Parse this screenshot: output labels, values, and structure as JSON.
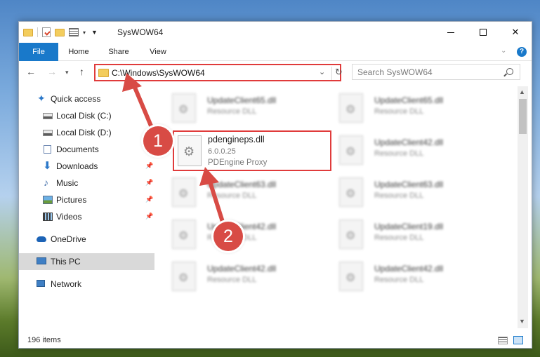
{
  "window": {
    "title": "SysWOW64"
  },
  "ribbon": {
    "tabs": [
      "File",
      "Home",
      "Share",
      "View"
    ],
    "help": "?"
  },
  "address": {
    "path": "C:\\Windows\\SysWOW64"
  },
  "search": {
    "placeholder": "Search SysWOW64"
  },
  "sidebar": {
    "items": [
      {
        "label": "Quick access",
        "icon": "star-icon"
      },
      {
        "label": "Local Disk (C:)",
        "icon": "drive-icon"
      },
      {
        "label": "Local Disk (D:)",
        "icon": "drive-icon"
      },
      {
        "label": "Documents",
        "icon": "documents-icon",
        "pinned": true
      },
      {
        "label": "Downloads",
        "icon": "download-icon",
        "pinned": true
      },
      {
        "label": "Music",
        "icon": "music-icon",
        "pinned": true
      },
      {
        "label": "Pictures",
        "icon": "pictures-icon",
        "pinned": true
      },
      {
        "label": "Videos",
        "icon": "videos-icon",
        "pinned": true
      },
      {
        "label": "OneDrive",
        "icon": "cloud-icon"
      },
      {
        "label": "This PC",
        "icon": "computer-icon",
        "selected": true
      },
      {
        "label": "Network",
        "icon": "network-icon"
      }
    ]
  },
  "files": [
    {
      "name": "UpdateClient65.dll",
      "desc": "Resource DLL"
    },
    {
      "name": "UpdateClient65.dll",
      "desc": "Resource DLL"
    },
    {
      "name": "UpdateClient42.dll",
      "desc": "Resource DLL"
    },
    {
      "name": "UpdateClient63.dll",
      "desc": "Resource DLL"
    },
    {
      "name": "UpdateClient63.dll",
      "desc": "Resource DLL"
    },
    {
      "name": "UpdateClient42.dll",
      "desc": "Resource DLL"
    },
    {
      "name": "UpdateClient19.dll",
      "desc": "Resource DLL"
    },
    {
      "name": "UpdateClient42.dll",
      "desc": "Resource DLL"
    },
    {
      "name": "UpdateClient42.dll",
      "desc": "Resource DLL"
    }
  ],
  "highlighted_file": {
    "name": "pdengineps.dll",
    "version": "6.0.0.25",
    "desc": "PDEngine Proxy"
  },
  "status": {
    "count": "196 items"
  },
  "annotations": {
    "step1": "1",
    "step2": "2",
    "color": "#d84b45"
  }
}
